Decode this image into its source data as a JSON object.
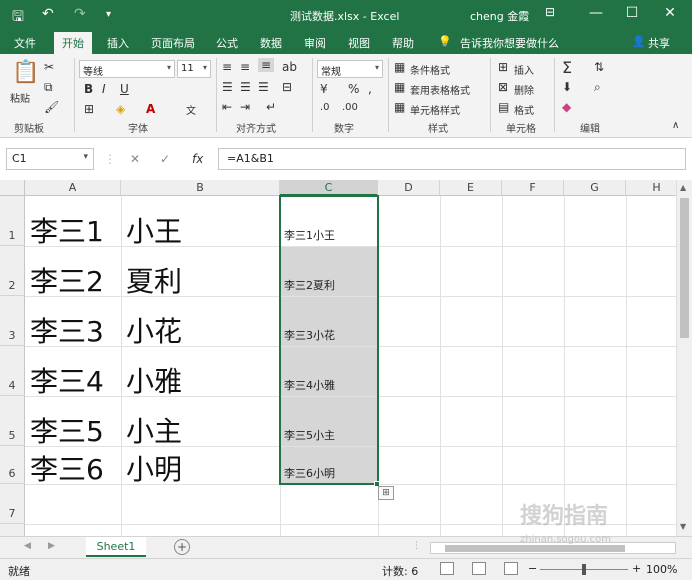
{
  "titlebar": {
    "title": "测试数据.xlsx - Excel",
    "user": "cheng 金霞"
  },
  "tabs": [
    "文件",
    "开始",
    "插入",
    "页面布局",
    "公式",
    "数据",
    "审阅",
    "视图",
    "帮助"
  ],
  "tell_me": "告诉我你想要做什么",
  "share": "共享",
  "ribbon": {
    "clipboard": {
      "paste": "粘贴",
      "label": "剪贴板"
    },
    "font": {
      "name": "等线",
      "size": "11",
      "label": "字体"
    },
    "alignment": {
      "label": "对齐方式"
    },
    "number": {
      "format": "常规",
      "label": "数字"
    },
    "styles": {
      "conditional": "条件格式",
      "table": "套用表格格式",
      "cell": "单元格样式",
      "label": "样式"
    },
    "cells": {
      "insert": "插入",
      "delete": "删除",
      "format": "格式",
      "label": "单元格"
    },
    "editing": {
      "label": "编辑"
    }
  },
  "formula_bar": {
    "name_box": "C1",
    "formula": "=A1&B1",
    "fx": "fx"
  },
  "columns": [
    "A",
    "B",
    "C",
    "D",
    "E",
    "F",
    "G",
    "H"
  ],
  "rows": [
    {
      "num": "1",
      "a": "李三1",
      "b": "小王",
      "c": "李三1小王"
    },
    {
      "num": "2",
      "a": "李三2",
      "b": "夏利",
      "c": "李三2夏利"
    },
    {
      "num": "3",
      "a": "李三3",
      "b": "小花",
      "c": "李三3小花"
    },
    {
      "num": "4",
      "a": "李三4",
      "b": "小雅",
      "c": "李三4小雅"
    },
    {
      "num": "5",
      "a": "李三5",
      "b": "小主",
      "c": "李三5小主"
    },
    {
      "num": "6",
      "a": "李三6",
      "b": "小明",
      "c": "李三6小明"
    },
    {
      "num": "7",
      "a": "",
      "b": "",
      "c": ""
    }
  ],
  "sheet_tab": "Sheet1",
  "status": {
    "ready": "就绪",
    "count": "计数: 6",
    "zoom": "100%"
  },
  "watermark": "搜狗指南",
  "watermark_url": "zhinan.sogou.com"
}
